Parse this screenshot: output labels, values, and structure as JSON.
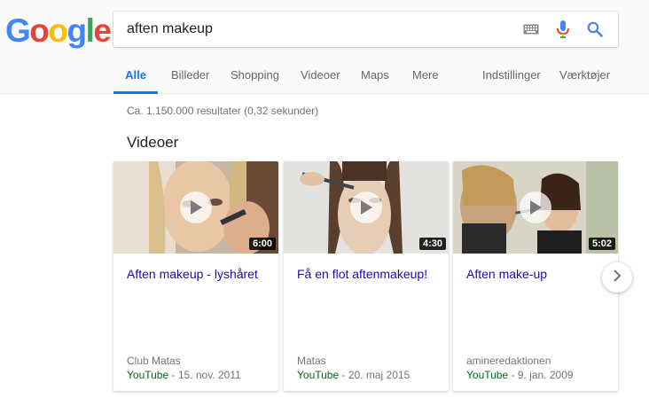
{
  "logo": {
    "letters": [
      "G",
      "o",
      "o",
      "g",
      "l",
      "e"
    ],
    "colors": [
      "#4285f4",
      "#ea4335",
      "#fbbc05",
      "#4285f4",
      "#34a853",
      "#ea4335"
    ]
  },
  "search": {
    "query": "aften makeup",
    "icons": [
      "keyboard-icon",
      "microphone-icon",
      "search-icon"
    ]
  },
  "tabs": {
    "all": "Alle",
    "images": "Billeder",
    "shopping": "Shopping",
    "videos": "Videoer",
    "maps": "Maps",
    "more": "Mere",
    "settings": "Indstillinger",
    "tools": "Værktøjer"
  },
  "accent_color": "#1a73e8",
  "results": {
    "stats": "Ca. 1.150.000 resultater (0,32 sekunder)"
  },
  "videos": {
    "title": "Videoer",
    "items": [
      {
        "title": "Aften makeup - lyshåret",
        "channel": "Club Matas",
        "source": "YouTube",
        "date": "- 15. nov. 2011",
        "duration": "6:00"
      },
      {
        "title": "Få en flot aftenmakeup!",
        "channel": "Matas",
        "source": "YouTube",
        "date": "- 20. maj 2015",
        "duration": "4:30"
      },
      {
        "title": "Aften make-up",
        "channel": "amineredaktionen",
        "source": "YouTube",
        "date": "- 9. jan. 2009",
        "duration": "5:02"
      }
    ]
  }
}
